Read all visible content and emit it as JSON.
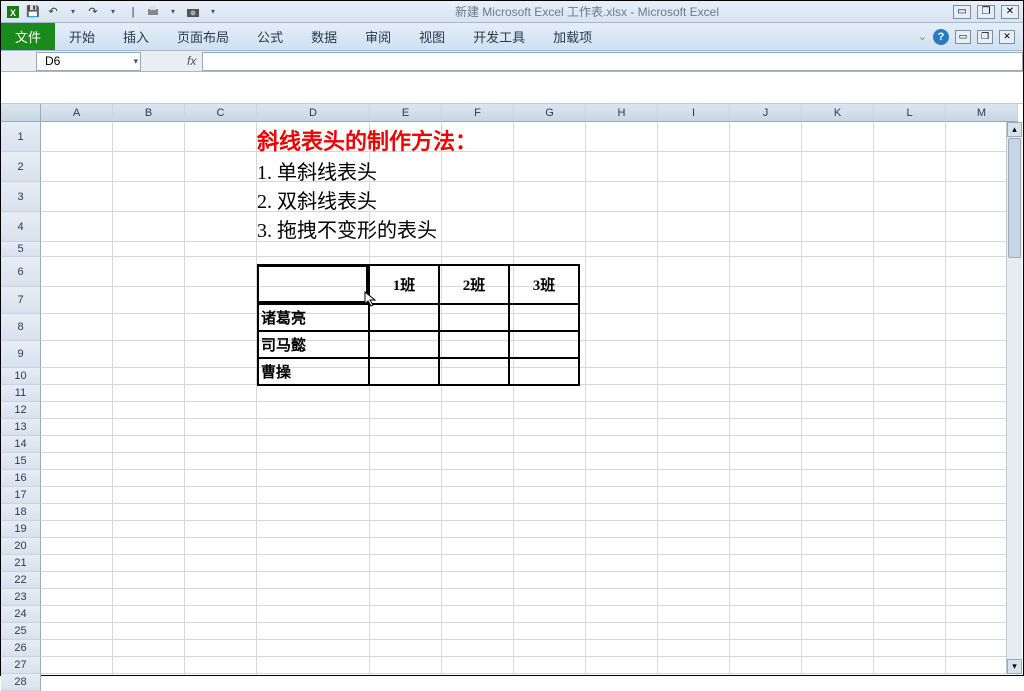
{
  "app": {
    "title": "新建 Microsoft Excel 工作表.xlsx - Microsoft Excel"
  },
  "qat": {
    "save": "💾",
    "undo": "↶",
    "redo": "↷"
  },
  "ribbon": {
    "file": "文件",
    "tabs": [
      "开始",
      "插入",
      "页面布局",
      "公式",
      "数据",
      "审阅",
      "视图",
      "开发工具",
      "加载项"
    ]
  },
  "formula": {
    "name_box": "D6",
    "fx": "fx",
    "value": ""
  },
  "columns": [
    "A",
    "B",
    "C",
    "D",
    "E",
    "F",
    "G",
    "H",
    "I",
    "J",
    "K",
    "L",
    "M"
  ],
  "rows_visible": 28,
  "content": {
    "title": "斜线表头的制作方法：",
    "items": [
      "1. 单斜线表头",
      "2. 双斜线表头",
      "3. 拖拽不变形的表头"
    ]
  },
  "table": {
    "header_row": [
      "",
      "1班",
      "2班",
      "3班"
    ],
    "rows": [
      [
        "诸葛亮",
        "",
        "",
        ""
      ],
      [
        "司马懿",
        "",
        "",
        ""
      ],
      [
        "曹操",
        "",
        "",
        ""
      ]
    ]
  },
  "active_cell": "D6",
  "cursor_glyph": "↖"
}
